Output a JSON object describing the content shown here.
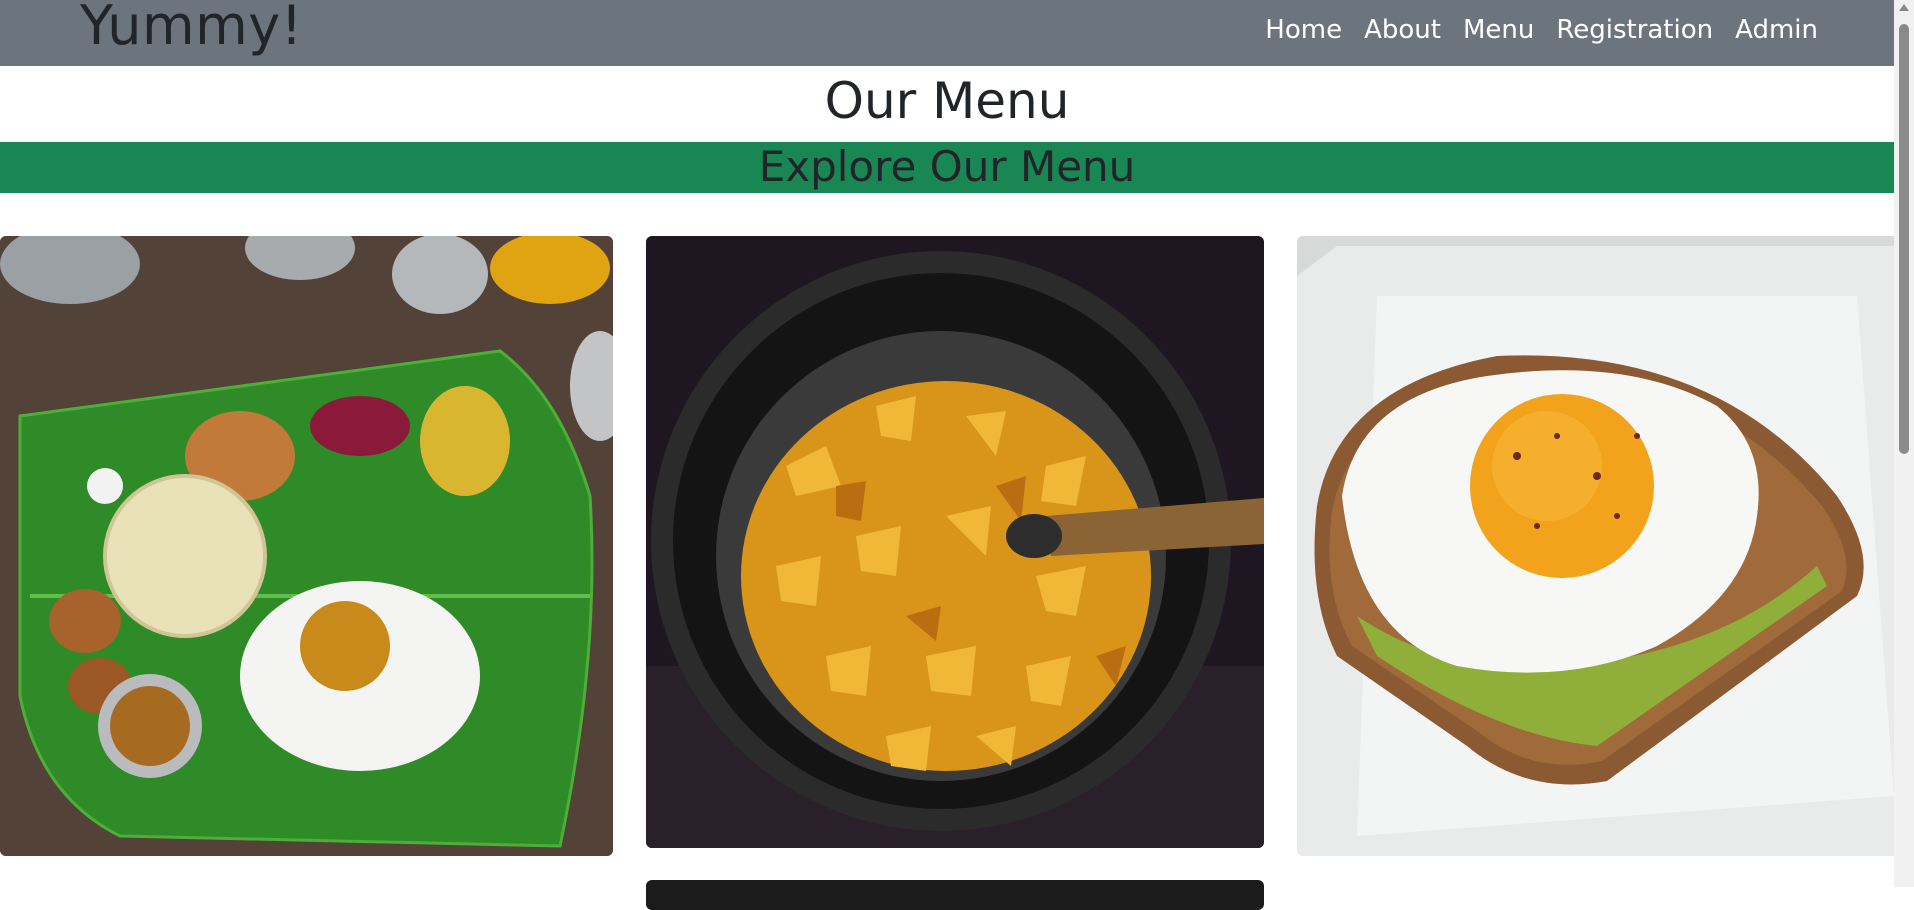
{
  "navbar": {
    "brand": "Yummy!",
    "links": [
      "Home",
      "About",
      "Menu",
      "Registration",
      "Admin"
    ]
  },
  "page": {
    "title": "Our Menu",
    "banner": "Explore Our Menu"
  },
  "cards": [
    {
      "image": "banana-leaf-meal"
    },
    {
      "image": "stir-fried-vegetables-in-pan"
    },
    {
      "image": "fried-egg-on-avocado-toast"
    },
    {
      "image": "dark-food-image"
    }
  ],
  "colors": {
    "navbar_bg": "#6c757d",
    "banner_bg": "#198754",
    "nav_text": "#ffffff",
    "heading_text": "#212529"
  }
}
